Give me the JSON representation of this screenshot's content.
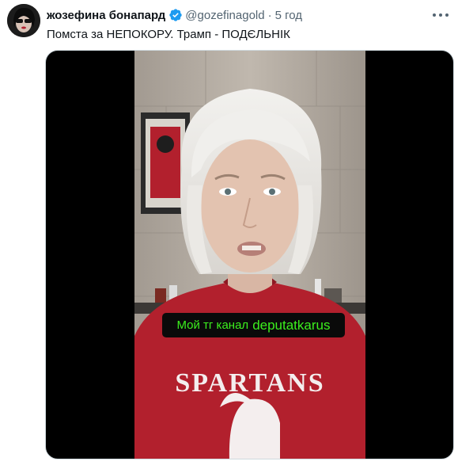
{
  "tweet": {
    "author_name": "жозефина бонапард",
    "verified": true,
    "handle": "@gozefinagold",
    "separator": "·",
    "time": "5 год",
    "text": "Помста за НЕПОКОРУ. Трамп - ПОДЄЛЬНІК"
  },
  "media": {
    "caption_prefix": "Мой тг канал",
    "caption_channel": "deputatkarus",
    "shirt_text": "SPARTANS"
  },
  "colors": {
    "accent_verified": "#1d9bf0",
    "caption_text": "#3cf01e",
    "shirt": "#b2202d",
    "secondary_text": "#536471"
  },
  "icons": [
    "verified-icon",
    "more-icon"
  ]
}
